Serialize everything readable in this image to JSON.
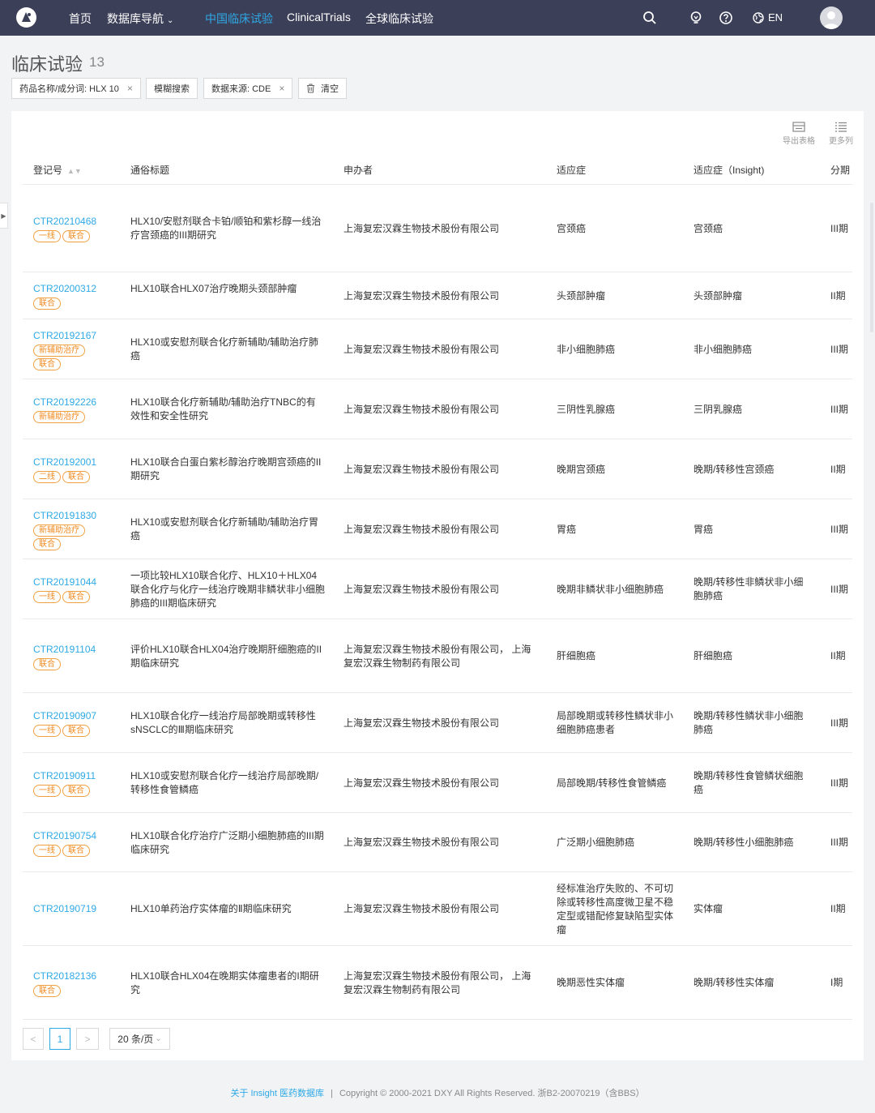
{
  "nav": {
    "home": "首页",
    "db_nav": "数据库导航",
    "cn_trials": "中国临床试验",
    "clinicaltrials": "ClinicalTrials",
    "global_trials": "全球临床试验",
    "lang": "EN"
  },
  "page": {
    "title": "临床试验",
    "count": "13"
  },
  "filters": {
    "drug": "药品名称/成分词: HLX 10",
    "fuzzy": "模糊搜索",
    "source": "数据来源: CDE",
    "clear": "清空"
  },
  "tools": {
    "export": "导出表格",
    "more_cols": "更多列"
  },
  "table": {
    "headers": {
      "reg_no": "登记号",
      "title": "通俗标题",
      "sponsor": "申办者",
      "indication": "适应症",
      "indication_insight": "适应症（Insight)",
      "phase": "分期"
    },
    "rows": [
      {
        "id": "CTR20210468",
        "tags": [
          "一线",
          "联合"
        ],
        "title": "HLX10/安慰剂联合卡铂/顺铂和紫杉醇一线治疗宫颈癌的III期研究",
        "sponsor": "上海复宏汉霖生物技术股份有限公司",
        "indication": "宫颈癌",
        "insight": "宫颈癌",
        "phase": "III期"
      },
      {
        "id": "CTR20200312",
        "tags": [
          "联合"
        ],
        "title": "HLX10联合HLX07治疗晚期头颈部肿瘤",
        "sponsor": "上海复宏汉霖生物技术股份有限公司",
        "indication": "头颈部肿瘤",
        "insight": "头颈部肿瘤",
        "phase": "II期"
      },
      {
        "id": "CTR20192167",
        "tags": [
          "新辅助治疗",
          "联合"
        ],
        "title": "HLX10或安慰剂联合化疗新辅助/辅助治疗肺癌",
        "sponsor": "上海复宏汉霖生物技术股份有限公司",
        "indication": "非小细胞肺癌",
        "insight": "非小细胞肺癌",
        "phase": "III期"
      },
      {
        "id": "CTR20192226",
        "tags": [
          "新辅助治疗"
        ],
        "title": "HLX10联合化疗新辅助/辅助治疗TNBC的有效性和安全性研究",
        "sponsor": "上海复宏汉霖生物技术股份有限公司",
        "indication": "三阴性乳腺癌",
        "insight": "三阴乳腺癌",
        "phase": "III期"
      },
      {
        "id": "CTR20192001",
        "tags": [
          "二线",
          "联合"
        ],
        "title": "HLX10联合白蛋白紫杉醇治疗晚期宫颈癌的II期研究",
        "sponsor": "上海复宏汉霖生物技术股份有限公司",
        "indication": "晚期宫颈癌",
        "insight": "晚期/转移性宫颈癌",
        "phase": "II期"
      },
      {
        "id": "CTR20191830",
        "tags": [
          "新辅助治疗",
          "联合"
        ],
        "title": "HLX10或安慰剂联合化疗新辅助/辅助治疗胃癌",
        "sponsor": "上海复宏汉霖生物技术股份有限公司",
        "indication": "胃癌",
        "insight": "胃癌",
        "phase": "III期"
      },
      {
        "id": "CTR20191044",
        "tags": [
          "一线",
          "联合"
        ],
        "title": "一项比较HLX10联合化疗、HLX10＋HLX04联合化疗与化疗一线治疗晚期非鳞状非小细胞肺癌的III期临床研究",
        "sponsor": "上海复宏汉霖生物技术股份有限公司",
        "indication": "晚期非鳞状非小细胞肺癌",
        "insight": "晚期/转移性非鳞状非小细胞肺癌",
        "phase": "III期"
      },
      {
        "id": "CTR20191104",
        "tags": [
          "联合"
        ],
        "title": "评价HLX10联合HLX04治疗晚期肝细胞癌的II期临床研究",
        "sponsor": "上海复宏汉霖生物技术股份有限公司， 上海复宏汉霖生物制药有限公司",
        "indication": "肝细胞癌",
        "insight": "肝细胞癌",
        "phase": "II期"
      },
      {
        "id": "CTR20190907",
        "tags": [
          "一线",
          "联合"
        ],
        "title": "HLX10联合化疗一线治疗局部晚期或转移性sNSCLC的Ⅲ期临床研究",
        "sponsor": "上海复宏汉霖生物技术股份有限公司",
        "indication": "局部晚期或转移性鳞状非小细胞肺癌患者",
        "insight": "晚期/转移性鳞状非小细胞肺癌",
        "phase": "III期"
      },
      {
        "id": "CTR20190911",
        "tags": [
          "一线",
          "联合"
        ],
        "title": "HLX10或安慰剂联合化疗一线治疗局部晚期/转移性食管鳞癌",
        "sponsor": "上海复宏汉霖生物技术股份有限公司",
        "indication": "局部晚期/转移性食管鳞癌",
        "insight": "晚期/转移性食管鳞状细胞癌",
        "phase": "III期"
      },
      {
        "id": "CTR20190754",
        "tags": [
          "一线",
          "联合"
        ],
        "title": "HLX10联合化疗治疗广泛期小细胞肺癌的III期临床研究",
        "sponsor": "上海复宏汉霖生物技术股份有限公司",
        "indication": "广泛期小细胞肺癌",
        "insight": "晚期/转移性小细胞肺癌",
        "phase": "III期"
      },
      {
        "id": "CTR20190719",
        "tags": [],
        "title": "HLX10单药治疗实体瘤的Ⅱ期临床研究",
        "sponsor": "上海复宏汉霖生物技术股份有限公司",
        "indication": "经标准治疗失败的、不可切除或转移性高度微卫星不稳定型或错配修复缺陷型实体瘤",
        "insight": "实体瘤",
        "phase": "II期"
      },
      {
        "id": "CTR20182136",
        "tags": [
          "联合"
        ],
        "title": "HLX10联合HLX04在晚期实体瘤患者的I期研究",
        "sponsor": "上海复宏汉霖生物技术股份有限公司， 上海复宏汉霖生物制药有限公司",
        "indication": "晚期恶性实体瘤",
        "insight": "晚期/转移性实体瘤",
        "phase": "I期"
      }
    ]
  },
  "pagination": {
    "prev": "<",
    "current": "1",
    "next": ">",
    "page_size": "20 条/页"
  },
  "footer": {
    "about": "关于 Insight 医药数据库",
    "sep": "|",
    "copyright": "Copyright © 2000-2021 DXY All Rights Reserved. 浙B2-20070219（含BBS）"
  },
  "colors": {
    "nav_bg": "#3c3f58",
    "accent": "#2ea9e6",
    "tag": "#f08a20"
  }
}
